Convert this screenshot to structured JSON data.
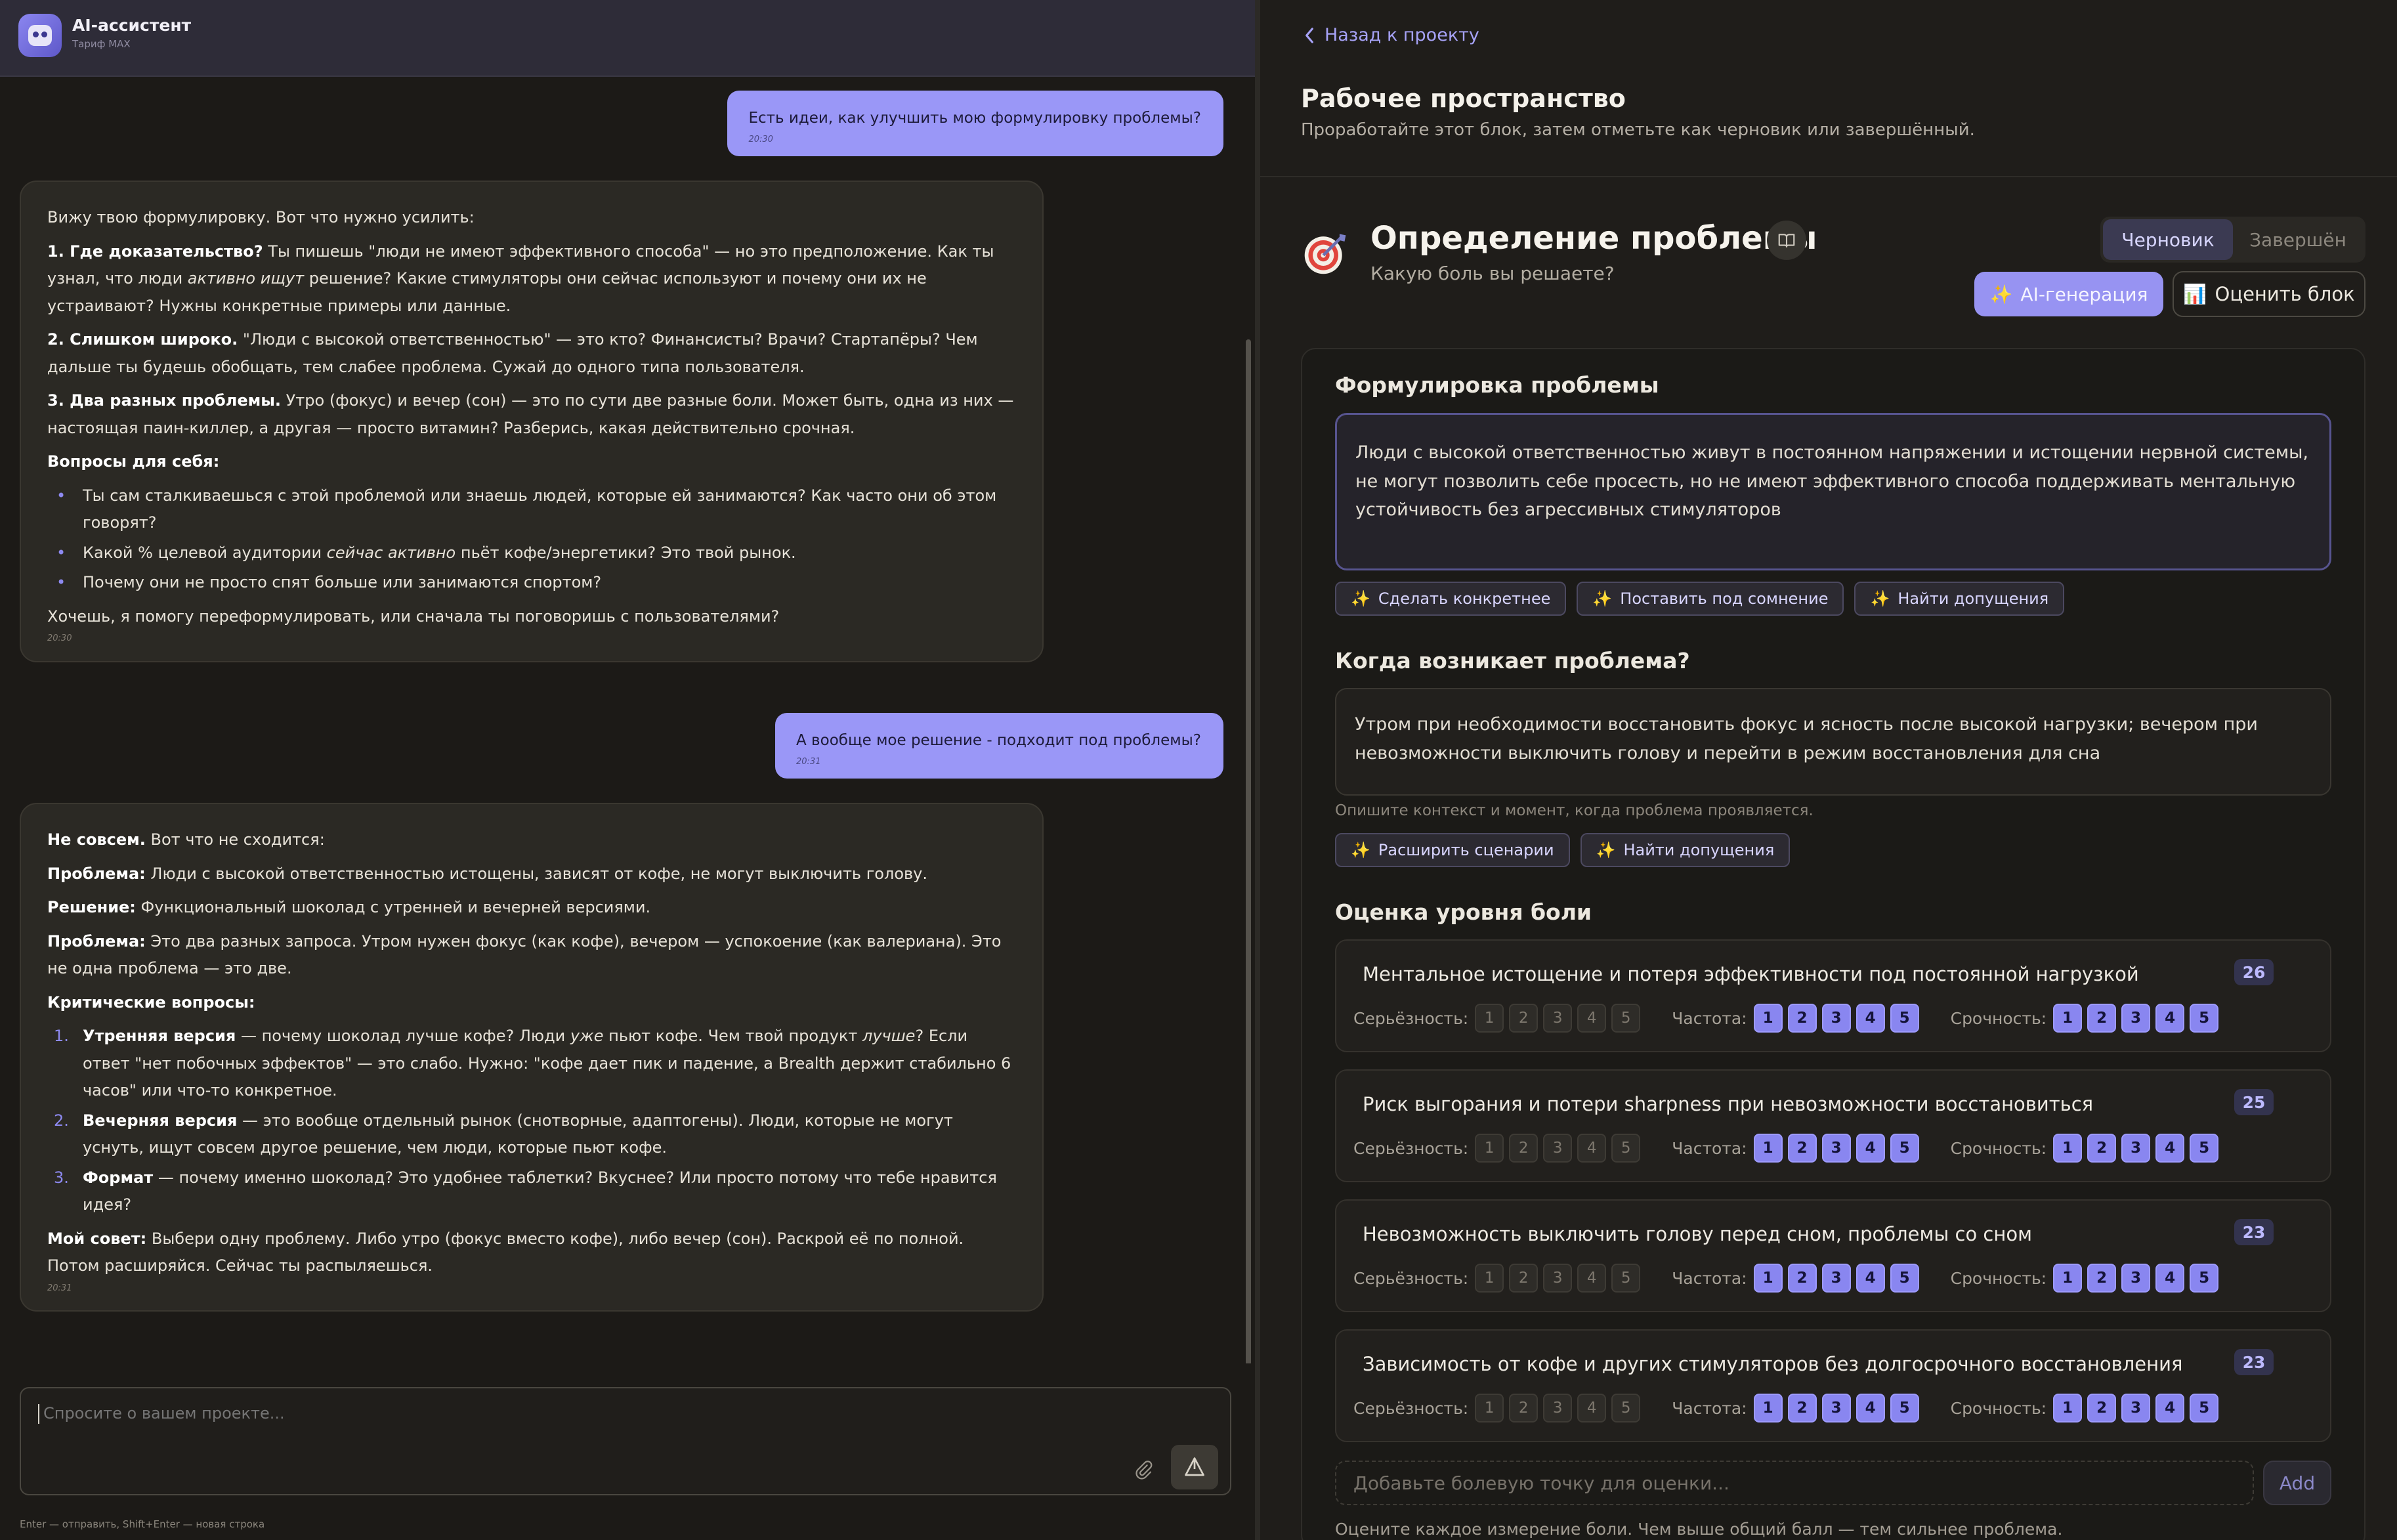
{
  "chat": {
    "title": "AI-ассистент",
    "plan": "Тариф MAX",
    "messages": [
      {
        "role": "user",
        "text": "Есть идеи, как улучшить мою формулировку проблемы?",
        "time": "20:30"
      },
      {
        "role": "ai",
        "intro": "Вижу твою формулировку. Вот что нужно усилить:",
        "p1_b": "1. Где доказательство?",
        "p1_a": " Ты пишешь \"люди не имеют эффективного способа\" — но это предположение. Как ты узнал, что люди ",
        "p1_i": "активно ищут",
        "p1_c": " решение? Какие стимуляторы они сейчас используют и почему они их не устраивают? Нужны конкретные примеры или данные.",
        "p2_b": "2. Слишком широко.",
        "p2_a": " \"Люди с высокой ответственностью\" — это кто? Финансисты? Врачи? Стартапёры? Чем дальше ты будешь обобщать, тем слабее проблема. Сужай до одного типа пользователя.",
        "p3_b": "3. Два разных проблемы.",
        "p3_a": " Утро (фокус) и вечер (сон) — это по сути две разные боли. Может быть, одна из них — настоящая паин-киллер, а другая — просто витамин? Разберись, какая действительно срочная.",
        "questions_h": "Вопросы для себя:",
        "q1": "Ты сам сталкиваешься с этой проблемой или знаешь людей, которые ей занимаются? Как часто они об этом говорят?",
        "q2_a": "Какой % целевой аудитории ",
        "q2_i": "сейчас активно",
        "q2_b": " пьёт кофе/энергетики? Это твой рынок.",
        "q3": "Почему они не просто спят больше или занимаются спортом?",
        "outro": "Хочешь, я помогу переформулировать, или сначала ты поговоришь с пользователями?",
        "time": "20:30"
      },
      {
        "role": "user",
        "text": "А вообще мое решение - подходит под проблемы?",
        "time": "20:31"
      },
      {
        "role": "ai",
        "l1_b": "Не совсем.",
        "l1_a": " Вот что не сходится:",
        "l2_b": "Проблема:",
        "l2_a": " Люди с высокой ответственностью истощены, зависят от кофе, не могут выключить голову.",
        "l3_b": "Решение:",
        "l3_a": " Функциональный шоколад с утренней и вечерней версиями.",
        "l4_b": "Проблема:",
        "l4_a": " Это два разных запроса. Утром нужен фокус (как кофе), вечером — успокоение (как валериана). Это не одна проблема — это две.",
        "critical_h": "Критические вопросы:",
        "c1_b": "Утренняя версия",
        "c1_a": " — почему шоколад лучше кофе? Люди ",
        "c1_i1": "уже",
        "c1_c": " пьют кофе. Чем твой продукт ",
        "c1_i2": "лучше",
        "c1_d": "? Если ответ \"нет побочных эффектов\" — это слабо. Нужно: \"кофе дает пик и падение, а Brealth держит стабильно 6 часов\" или что-то конкретное.",
        "c2_b": "Вечерняя версия",
        "c2_a": " — это вообще отдельный рынок (снотворные, адаптогены). Люди, которые не могут уснуть, ищут совсем другое решение, чем люди, которые пьют кофе.",
        "c3_b": "Формат",
        "c3_a": " — почему именно шоколад? Это удобнее таблетки? Вкуснее? Или просто потому что тебе нравится идея?",
        "advice_b": "Мой совет:",
        "advice_a": " Выбери одну проблему. Либо утро (фокус вместо кофе), либо вечер (сон). Раскрой её по полной. Потом расширяйся. Сейчас ты распыляешься.",
        "time": "20:31"
      }
    ],
    "composer_placeholder": "Спросите о вашем проекте...",
    "composer_hint": "Enter — отправить, Shift+Enter — новая строка"
  },
  "workspace": {
    "back_label": "Назад к проекту",
    "title": "Рабочее пространство",
    "subtitle": "Проработайте этот блок, затем отметьте как черновик или завершённый.",
    "block": {
      "title": "Определение проблемы",
      "subtitle": "Какую боль вы решаете?",
      "status_options": [
        "Черновик",
        "Завершён"
      ],
      "status_selected": "Черновик",
      "ai_gen_label": "AI-генерация",
      "eval_label": "Оценить блок"
    },
    "problem": {
      "heading": "Формулировка проблемы",
      "value": "Люди с высокой ответственностью живут в постоянном напряжении и истощении нервной системы, не могут позволить себе просесть, но не имеют эффективного способа поддерживать ментальную устойчивость без агрессивных стимуляторов",
      "chips": [
        "Сделать конкретнее",
        "Поставить под сомнение",
        "Найти допущения"
      ]
    },
    "when": {
      "heading": "Когда возникает проблема?",
      "value": "Утром при необходимости восстановить фокус и ясность после высокой нагрузки; вечером при невозможности выключить голову и перейти в режим восстановления для сна",
      "hint": "Опишите контекст и момент, когда проблема проявляется.",
      "chips": [
        "Расширить сценарии",
        "Найти допущения"
      ]
    },
    "pain": {
      "heading": "Оценка уровня боли",
      "dimension_labels": {
        "severity": "Серьёзность:",
        "frequency": "Частота:",
        "urgency": "Срочность:"
      },
      "items": [
        {
          "title": "Ментальное истощение и потеря эффективности под постоянной нагрузкой",
          "score": "26",
          "severity": 0,
          "frequency": 5,
          "urgency": 5
        },
        {
          "title": "Риск выгорания и потери sharpness при невозможности восстановиться",
          "score": "25",
          "severity": 0,
          "frequency": 5,
          "urgency": 5
        },
        {
          "title": "Невозможность выключить голову перед сном, проблемы со сном",
          "score": "23",
          "severity": 0,
          "frequency": 5,
          "urgency": 5
        },
        {
          "title": "Зависимость от кофе и других стимуляторов без долгосрочного восстановления",
          "score": "23",
          "severity": 0,
          "frequency": 5,
          "urgency": 5
        }
      ],
      "add_placeholder": "Добавьте болевую точку для оценки...",
      "add_label": "Add",
      "footnote": "Оцените каждое измерение боли. Чем выше общий балл — тем сильнее проблема."
    }
  },
  "colors": {
    "accent": "#9a97f7",
    "user_bubble": "#9a97f7",
    "background": "#1c1a17",
    "rating_on": "#8986f0"
  }
}
